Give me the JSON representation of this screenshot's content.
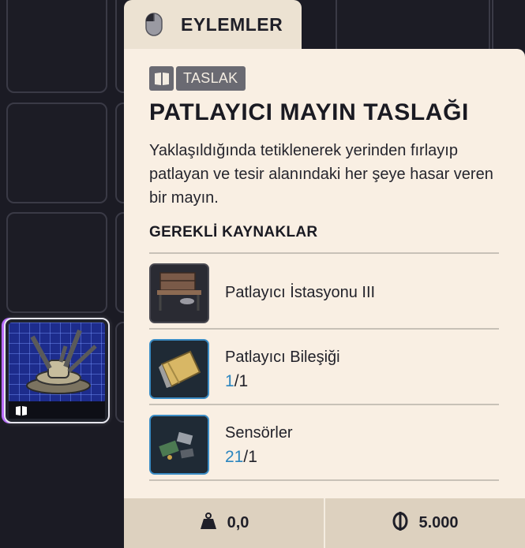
{
  "tab": {
    "label": "EYLEMLER",
    "icon": "mouse-icon"
  },
  "item": {
    "category": "TASLAK",
    "category_icon": "book-icon",
    "title": "PATLAYICI MAYIN TASLAĞI",
    "description": "Yaklaşıldığında tetiklenerek yerinden fırlayıp patlayan ve tesir alanındaki her şeye hasar veren bir mayın."
  },
  "requirements": {
    "heading": "GEREKLİ KAYNAKLAR",
    "items": [
      {
        "name": "Patlayıcı İstasyonu III",
        "have": "",
        "sep": "",
        "need": ""
      },
      {
        "name": "Patlayıcı Bileşiği",
        "have": "1",
        "sep": "/",
        "need": "1"
      },
      {
        "name": "Sensörler",
        "have": "21",
        "sep": "/",
        "need": "1"
      }
    ]
  },
  "footer": {
    "weight": "0,0",
    "weight_icon": "weight-icon",
    "price": "5.000",
    "price_icon": "coin-icon"
  },
  "colors": {
    "accent_blue": "#2c86bf",
    "panel_bg": "#f9efe3",
    "badge_bg": "#6a6a72"
  }
}
